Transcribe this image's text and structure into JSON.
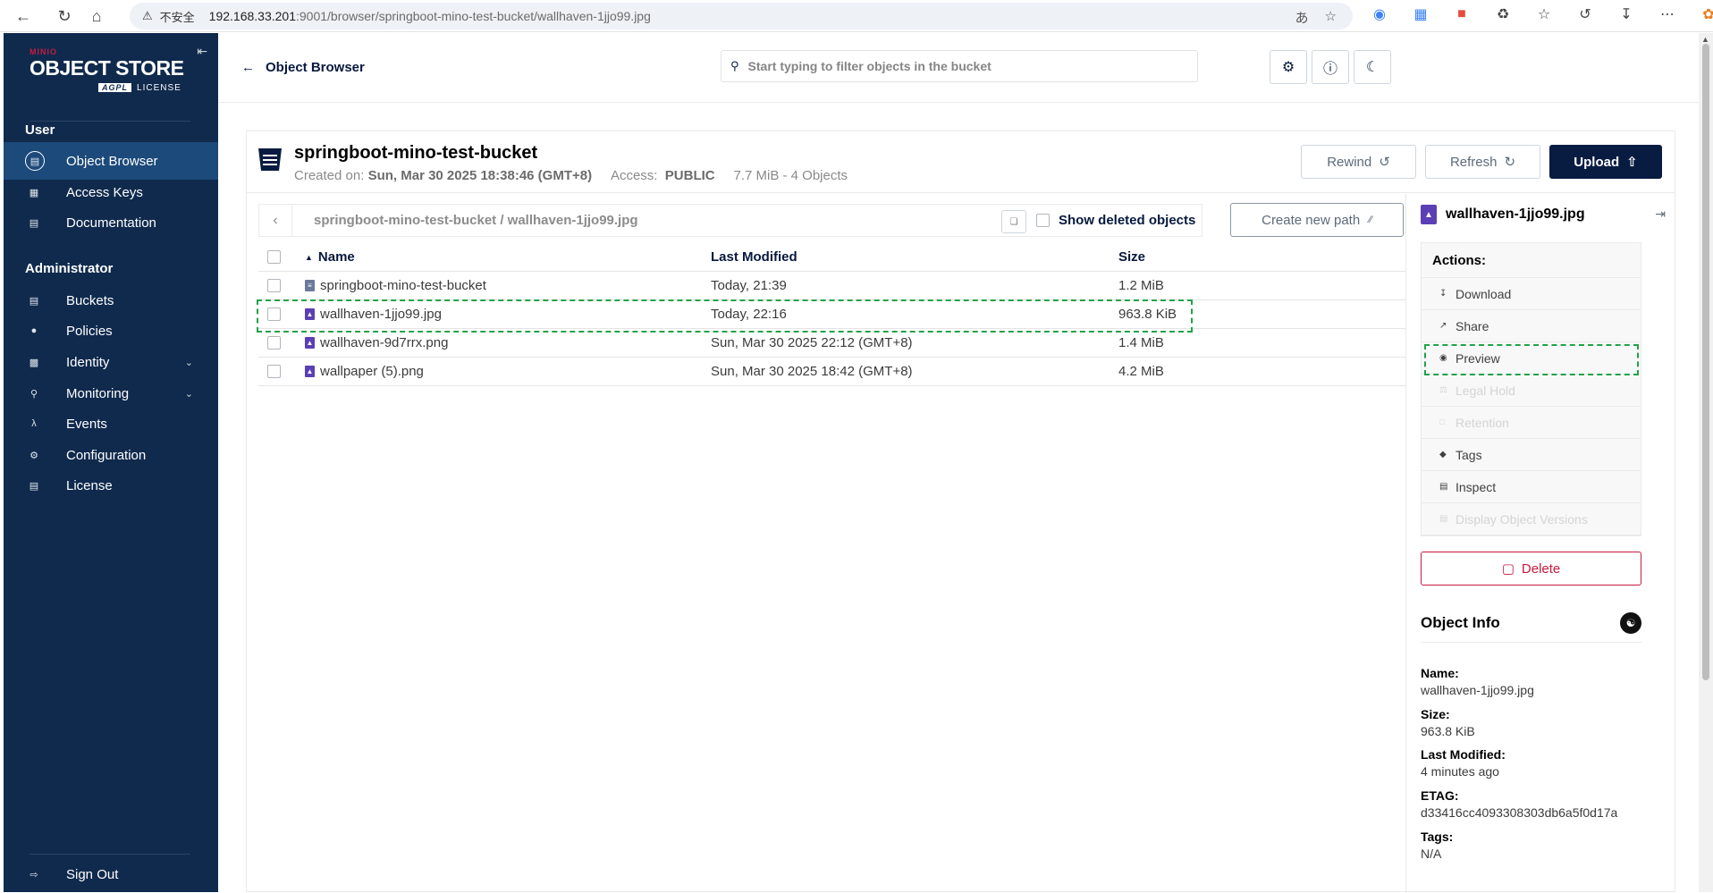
{
  "browser": {
    "insecure_label": "不安全",
    "url_host": "192.168.33.201",
    "url_path": ":9001/browser/springboot-mino-test-bucket/wallhaven-1jjo99.jpg"
  },
  "sidebar": {
    "logo_small": "MINIO",
    "logo_main": "OBJECT STORE",
    "logo_badge": "AGPL",
    "logo_license": "LICENSE",
    "user_section": "User",
    "user_items": [
      {
        "label": "Object Browser"
      },
      {
        "label": "Access Keys"
      },
      {
        "label": "Documentation"
      }
    ],
    "admin_section": "Administrator",
    "admin_items": [
      {
        "label": "Buckets"
      },
      {
        "label": "Policies"
      },
      {
        "label": "Identity"
      },
      {
        "label": "Monitoring"
      },
      {
        "label": "Events"
      },
      {
        "label": "Configuration"
      },
      {
        "label": "License"
      }
    ],
    "sign_out": "Sign Out"
  },
  "topbar": {
    "back_label": "Object Browser",
    "search_placeholder": "Start typing to filter objects in the bucket"
  },
  "bucket": {
    "name": "springboot-mino-test-bucket",
    "created_label": "Created on:",
    "created_value": "Sun, Mar 30 2025 18:38:46 (GMT+8)",
    "access_label": "Access:",
    "access_value": "PUBLIC",
    "usage": "7.7 MiB - 4 Objects",
    "rewind_label": "Rewind",
    "refresh_label": "Refresh",
    "upload_label": "Upload"
  },
  "browser_list": {
    "path": "springboot-mino-test-bucket / wallhaven-1jjo99.jpg",
    "show_deleted_label": "Show deleted objects",
    "create_path_label": "Create new path",
    "columns": {
      "name": "Name",
      "modified": "Last Modified",
      "size": "Size"
    },
    "rows": [
      {
        "name": "springboot-mino-test-bucket",
        "modified": "Today, 21:39",
        "size": "1.2 MiB"
      },
      {
        "name": "wallhaven-1jjo99.jpg",
        "modified": "Today, 22:16",
        "size": "963.8 KiB"
      },
      {
        "name": "wallhaven-9d7rrx.png",
        "modified": "Sun, Mar 30 2025 22:12 (GMT+8)",
        "size": "1.4 MiB"
      },
      {
        "name": "wallpaper (5).png",
        "modified": "Sun, Mar 30 2025 18:42 (GMT+8)",
        "size": "4.2 MiB"
      }
    ]
  },
  "detail": {
    "title": "wallhaven-1jjo99.jpg",
    "actions_label": "Actions:",
    "actions": [
      {
        "label": "Download"
      },
      {
        "label": "Share"
      },
      {
        "label": "Preview"
      },
      {
        "label": "Legal Hold"
      },
      {
        "label": "Retention"
      },
      {
        "label": "Tags"
      },
      {
        "label": "Inspect"
      },
      {
        "label": "Display Object Versions"
      }
    ],
    "delete_label": "Delete",
    "object_info_title": "Object Info",
    "info": {
      "name_label": "Name:",
      "name_value": "wallhaven-1jjo99.jpg",
      "size_label": "Size:",
      "size_value": "963.8 KiB",
      "modified_label": "Last Modified:",
      "modified_value": "4 minutes ago",
      "etag_label": "ETAG:",
      "etag_value": "d33416cc4093308303db6a5f0d17a",
      "tags_label": "Tags:",
      "tags_value": "N/A"
    }
  }
}
